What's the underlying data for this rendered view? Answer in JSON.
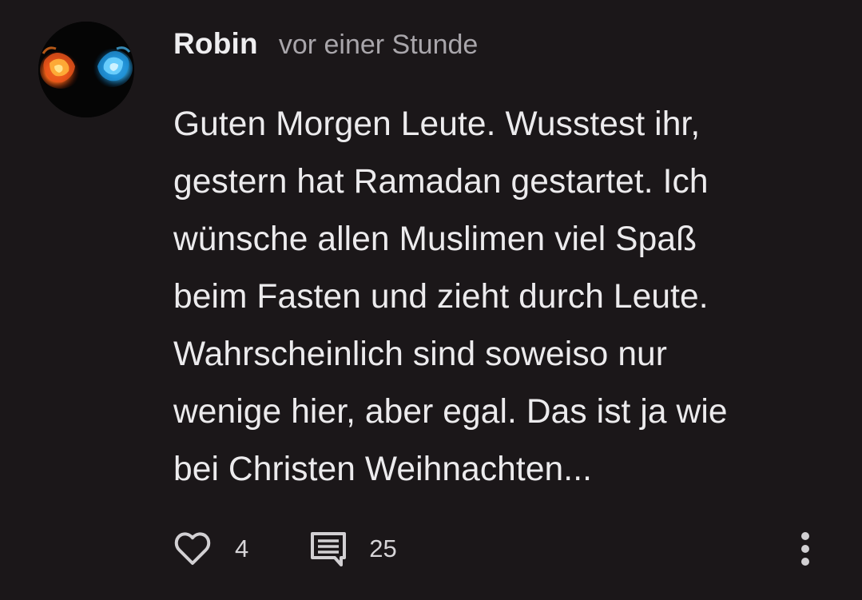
{
  "comment": {
    "author": "Robin",
    "timestamp": "vor einer Stunde",
    "text": "Guten Morgen Leute. Wusstest ihr,\ngestern hat Ramadan gestartet. Ich\nwünsche allen Muslimen viel Spaß\nbeim Fasten und zieht durch Leute.\nWahrscheinlich sind soweiso nur\nwenige hier, aber egal. Das ist ja wie\nbei Christen Weihnachten...",
    "likes": "4",
    "replies": "25"
  },
  "icons": {
    "like": "heart-outline-icon",
    "reply": "comment-icon",
    "more": "more-vertical-icon"
  },
  "colors": {
    "background": "#1b1719",
    "text": "#ecebed",
    "muted": "#a9a6ab",
    "icon": "#d2d0d3"
  }
}
